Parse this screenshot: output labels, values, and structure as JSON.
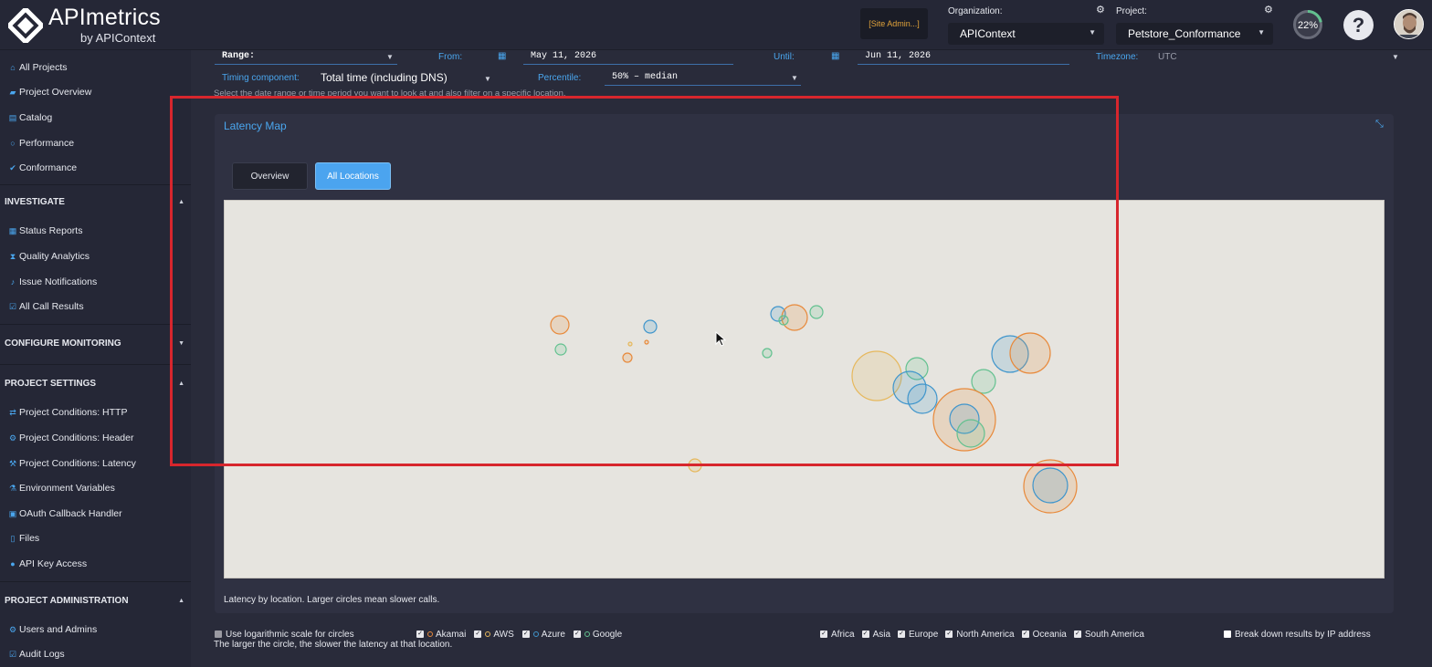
{
  "header": {
    "logo_title": "APImetrics",
    "logo_subtitle": "by APIContext",
    "site_admin_label": "[Site Admin...]",
    "organization_label": "Organization:",
    "organization_value": "APIContext",
    "project_label": "Project:",
    "project_value": "Petstore_Conformance",
    "progress_text": "22%",
    "progress_value": 0.22,
    "help_label": "?"
  },
  "sidebar": {
    "top_items": [
      {
        "label": "All Projects",
        "icon": "home-icon"
      },
      {
        "label": "Project Overview",
        "icon": "folder-icon"
      },
      {
        "label": "Catalog",
        "icon": "catalog-icon"
      },
      {
        "label": "Performance",
        "icon": "gauge-icon"
      },
      {
        "label": "Conformance",
        "icon": "check-icon"
      }
    ],
    "investigate": {
      "title": "INVESTIGATE",
      "items": [
        {
          "label": "Status Reports",
          "icon": "table-icon"
        },
        {
          "label": "Quality Analytics",
          "icon": "hourglass-icon"
        },
        {
          "label": "Issue Notifications",
          "icon": "bell-icon"
        },
        {
          "label": "All Call Results",
          "icon": "checkbox-icon"
        }
      ]
    },
    "configure": {
      "title": "CONFIGURE MONITORING"
    },
    "project_settings": {
      "title": "PROJECT SETTINGS",
      "items": [
        {
          "label": "Project Conditions: HTTP",
          "icon": "arrows-icon"
        },
        {
          "label": "Project Conditions: Header",
          "icon": "gear-icon"
        },
        {
          "label": "Project Conditions: Latency",
          "icon": "wrench-icon"
        },
        {
          "label": "Environment Variables",
          "icon": "flask-icon"
        },
        {
          "label": "OAuth Callback Handler",
          "icon": "lock-icon"
        },
        {
          "label": "Files",
          "icon": "file-icon"
        },
        {
          "label": "API Key Access",
          "icon": "info-icon"
        }
      ]
    },
    "administration": {
      "title": "PROJECT ADMINISTRATION",
      "items": [
        {
          "label": "Users and Admins",
          "icon": "gear-icon"
        },
        {
          "label": "Audit Logs",
          "icon": "checkbox-icon"
        }
      ]
    }
  },
  "filters": {
    "range_label": "Range:",
    "from_label": "From:",
    "from_value": "May 11, 2026",
    "until_label": "Until:",
    "until_value": "Jun 11, 2026",
    "timezone_label": "Timezone:",
    "timezone_value": "UTC",
    "timing_label": "Timing component:",
    "timing_value": "Total time (including DNS)",
    "percentile_label": "Percentile:",
    "percentile_value": "50% – median",
    "hint": "Select the date range or time period you want to look at and also filter on a specific location."
  },
  "panel": {
    "title": "Latency Map",
    "tabs": [
      "Overview",
      "All Locations"
    ],
    "active_tab": "All Locations",
    "caption": "Latency by location. Larger circles mean slower calls."
  },
  "colors": {
    "accent": "#4aa6ee",
    "akamai": "#e8893a",
    "aws": "#e6b85c",
    "azure": "#3f95cc",
    "google": "#62c18f",
    "highlight": "#d7262d"
  },
  "options": {
    "log_scale_label": "Use logarithmic scale for circles",
    "log_scale_checked": false,
    "providers": [
      {
        "label": "Akamai",
        "checked": true,
        "color_key": "akamai"
      },
      {
        "label": "AWS",
        "checked": true,
        "color_key": "aws"
      },
      {
        "label": "Azure",
        "checked": true,
        "color_key": "azure"
      },
      {
        "label": "Google",
        "checked": true,
        "color_key": "google"
      }
    ],
    "regions": [
      {
        "label": "Africa",
        "checked": true
      },
      {
        "label": "Asia",
        "checked": true
      },
      {
        "label": "Europe",
        "checked": true
      },
      {
        "label": "North America",
        "checked": true
      },
      {
        "label": "Oceania",
        "checked": true
      },
      {
        "label": "South America",
        "checked": true
      }
    ],
    "breakdown_label": "Break down results by IP address",
    "breakdown_checked": false,
    "note": "The larger the circle, the slower the latency at that location."
  }
}
